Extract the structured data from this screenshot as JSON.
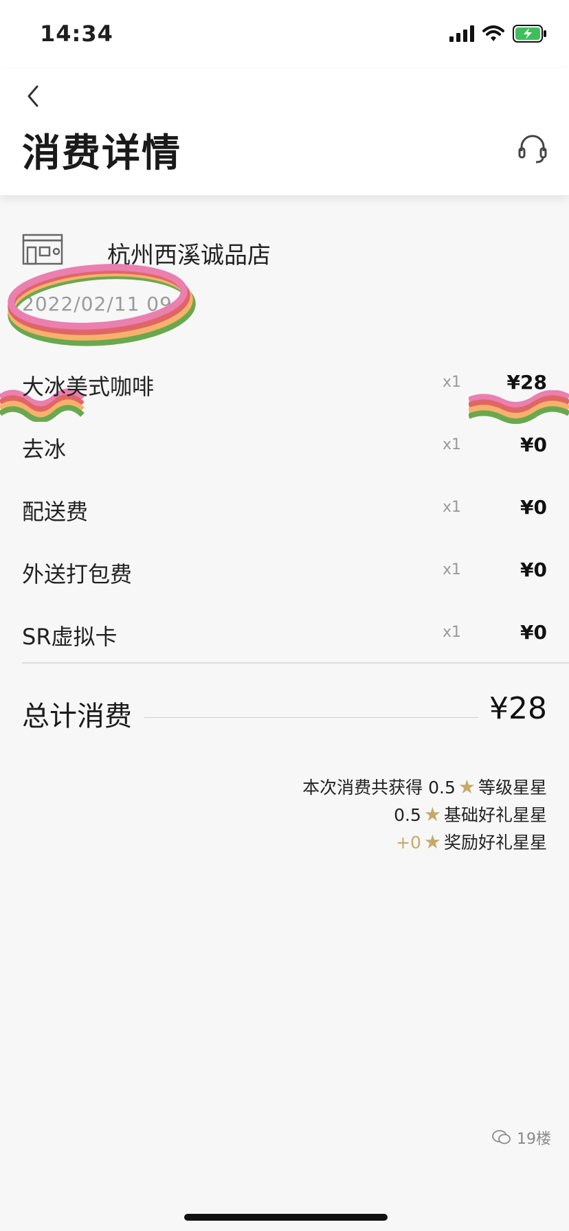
{
  "status_bar": {
    "time": "14:34",
    "battery_color": "#3fbf5c"
  },
  "header": {
    "title": "消费详情",
    "back_icon": "chevron-left-icon",
    "support_icon": "headset-icon"
  },
  "store": {
    "name": "杭州西溪诚品店",
    "date": "2022/02/11 09:1",
    "icon": "store-icon"
  },
  "items": [
    {
      "name": "大冰美式咖啡",
      "qty": "x1",
      "price": "¥28"
    },
    {
      "name": "去冰",
      "qty": "x1",
      "price": "¥0"
    },
    {
      "name": "配送费",
      "qty": "x1",
      "price": "¥0"
    },
    {
      "name": "外送打包费",
      "qty": "x1",
      "price": "¥0"
    },
    {
      "name": "SR虚拟卡",
      "qty": "x1",
      "price": "¥0"
    }
  ],
  "total": {
    "label": "总计消费",
    "value": "¥28"
  },
  "stars": {
    "line1_prefix": "本次消费共获得 0.5",
    "line1_suffix": "等级星星",
    "line2_prefix": "0.5",
    "line2_suffix": "基础好礼星星",
    "line3_prefix": "+0",
    "line3_suffix": "奖励好礼星星",
    "star_color": "#c6a969"
  },
  "watermark": {
    "text": "19楼"
  }
}
